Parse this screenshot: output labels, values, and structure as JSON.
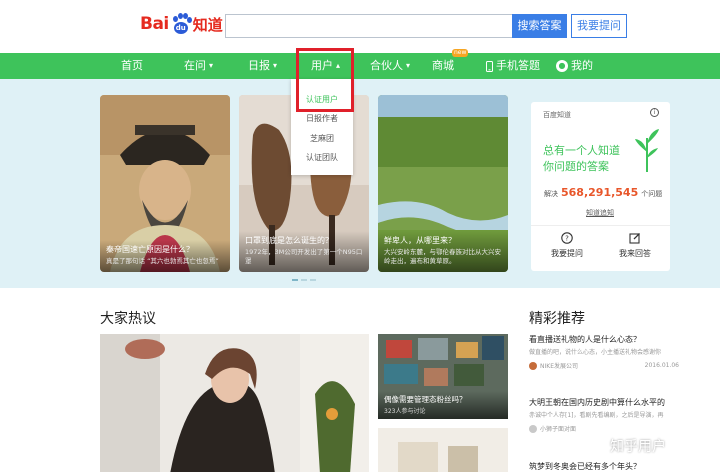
{
  "header": {
    "logo_text": "Bai",
    "logo_paw_text": "du",
    "logo_zhidao": "知道",
    "search_placeholder": "",
    "search_button": "搜索答案",
    "ask_button": "我要提问"
  },
  "nav": {
    "items": [
      {
        "label": "首页"
      },
      {
        "label": "在问"
      },
      {
        "label": "日报"
      },
      {
        "label": "用户"
      },
      {
        "label": "合伙人"
      },
      {
        "label": "商城"
      },
      {
        "label": "手机答题"
      },
      {
        "label": "我的"
      }
    ],
    "mall_badge": "new"
  },
  "dropdown": {
    "items": [
      "认证用户",
      "日报作者",
      "芝麻团",
      "认证团队"
    ]
  },
  "hero": {
    "cards": [
      {
        "title": "秦帝国速亡原因是什么？",
        "sub": "真是了那句话 “其六也勃焉其亡也忽焉”"
      },
      {
        "title": "口罩到底是怎么诞生的？",
        "sub": "1972年，3M公司开发出了第一个N95口罩"
      },
      {
        "title": "鲜卑人，从哪里来？",
        "sub": "大兴安岭东麓，与鄂伦春族对比从大兴安岭走出，遍布和黄草原。"
      }
    ]
  },
  "side_panel": {
    "header": "百度知道",
    "slogan_line1": "总有一个人知道",
    "slogan_line2": "你问题的答案",
    "solved_prefix": "解决",
    "solved_count": "568,291,545",
    "solved_suffix": "个问题",
    "more_link": "知道追知",
    "ask_label": "我要提问",
    "answer_label": "我来回答"
  },
  "sections": {
    "hot_title": "大家热议",
    "rec_title": "精彩推荐"
  },
  "hot": {
    "thumbs": [
      {
        "title": "偶像需要管理态粉丝吗？",
        "sub": "323人参与讨论"
      }
    ]
  },
  "recommend": [
    {
      "title": "看直播送礼物的人是什么心态？",
      "desc": "做直播的吧，说什么心态，小主播送礼物会感谢你",
      "author": "NIKE发展公司",
      "date": "2016.01.06"
    },
    {
      "title": "大明王朝在国内历史剧中算什么水平的",
      "desc": "赤诚中个人存[1]，看剧先看编剧，之后是导演，再",
      "author": "小狮子面对面",
      "date": ""
    },
    {
      "title": "筑梦到冬奥会已经有多个年头？",
      "desc": "",
      "author": "",
      "date": ""
    }
  ],
  "watermark": "知乎用户",
  "colors": {
    "nav_green": "#3ec35b",
    "brand_red": "#e52a1f",
    "brand_blue": "#2b5bd7",
    "search_blue": "#3a7ee6",
    "hero_bg": "#dff1f6",
    "highlight_red": "#e0202a",
    "count_orange": "#e8562a"
  }
}
